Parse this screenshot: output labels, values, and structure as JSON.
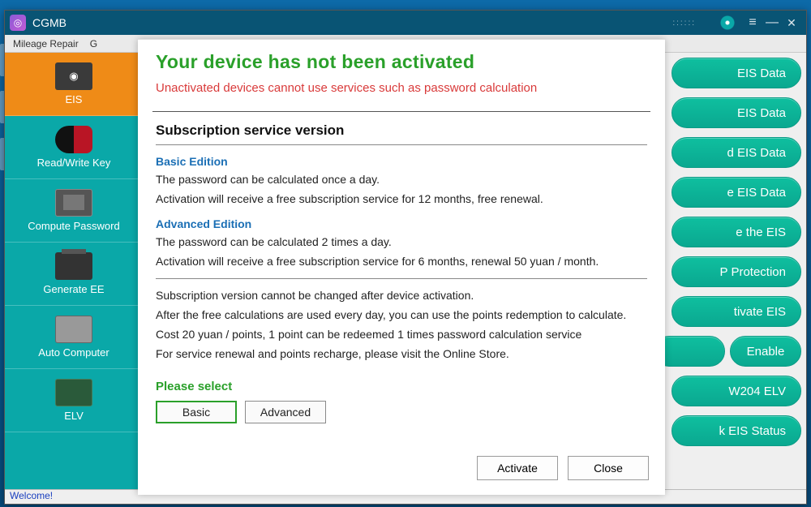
{
  "titlebar": {
    "app_name": "CGMB"
  },
  "menubar": {
    "item0": "Mileage Repair",
    "item1": "G"
  },
  "sidebar": {
    "items": [
      {
        "label": "EIS"
      },
      {
        "label": "Read/Write Key"
      },
      {
        "label": "Compute Password"
      },
      {
        "label": "Generate EE"
      },
      {
        "label": "Auto Computer"
      },
      {
        "label": "ELV"
      }
    ]
  },
  "actions": {
    "items": [
      "EIS Data",
      "EIS Data",
      "d EIS Data",
      "e EIS Data",
      "e the EIS",
      "P Protection",
      "tivate EIS"
    ],
    "row": {
      "left": "",
      "right": "Enable"
    },
    "tail": [
      "W204 ELV",
      "k EIS Status"
    ]
  },
  "dialog": {
    "title": "Your device has not been activated",
    "warn": "Unactivated devices cannot use services such as password calculation",
    "section_title": "Subscription service version",
    "basic": {
      "title": "Basic Edition",
      "line1": "The password can be calculated once a day.",
      "line2": "Activation will receive a free subscription service for 12 months, free renewal."
    },
    "adv": {
      "title": "Advanced Edition",
      "line1": "The password can be calculated 2 times a day.",
      "line2": "Activation will receive a free subscription service for 6 months, renewal 50 yuan / month."
    },
    "notes": {
      "n1": "Subscription version cannot be changed after device activation.",
      "n2": "After the free calculations are used every day, you can use the points redemption to calculate.",
      "n3": "Cost 20 yuan / points, 1 point can be redeemed 1 times password calculation service",
      "n4": "For service renewal and points recharge, please visit the Online Store."
    },
    "select_label": "Please select",
    "opt_basic": "Basic",
    "opt_adv": "Advanced",
    "btn_activate": "Activate",
    "btn_close": "Close"
  },
  "statusbar": {
    "text": "Welcome!"
  }
}
